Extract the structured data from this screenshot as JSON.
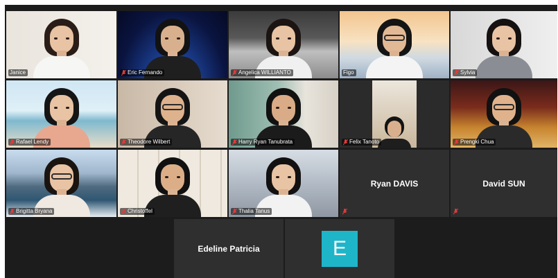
{
  "colors": {
    "active_speaker_border": "#ffe94d",
    "tile_background": "#2f2f2f",
    "mic_muted": "#e23b3b",
    "avatar_e": "#1fb5c9"
  },
  "participants": [
    {
      "name": "Janice",
      "muted": false,
      "active_speaker": true
    },
    {
      "name": "Eric Fernando",
      "muted": true
    },
    {
      "name": "Angelica WILLIANTO",
      "muted": true
    },
    {
      "name": "Figo",
      "muted": false
    },
    {
      "name": "Sylvia",
      "muted": true
    },
    {
      "name": "Rafael Lendy",
      "muted": true
    },
    {
      "name": "Theodore Wilbert",
      "muted": true
    },
    {
      "name": "Harry Ryan Tanubrata",
      "muted": true
    },
    {
      "name": "Felix Tanoto",
      "muted": true
    },
    {
      "name": "Prengki Chua",
      "muted": true
    },
    {
      "name": "Brigitta Bryana",
      "muted": true
    },
    {
      "name": "Christoffel",
      "muted": true
    },
    {
      "name": "Thalia Tanus",
      "muted": true
    },
    {
      "name": "Ryan DAVIS",
      "muted": true,
      "video_off": true
    },
    {
      "name": "David SUN",
      "muted": true,
      "video_off": true
    },
    {
      "name": "Edeline Patricia",
      "muted": false,
      "video_off": true
    },
    {
      "name": "",
      "avatar_letter": "E",
      "muted": false,
      "video_off": true
    }
  ]
}
